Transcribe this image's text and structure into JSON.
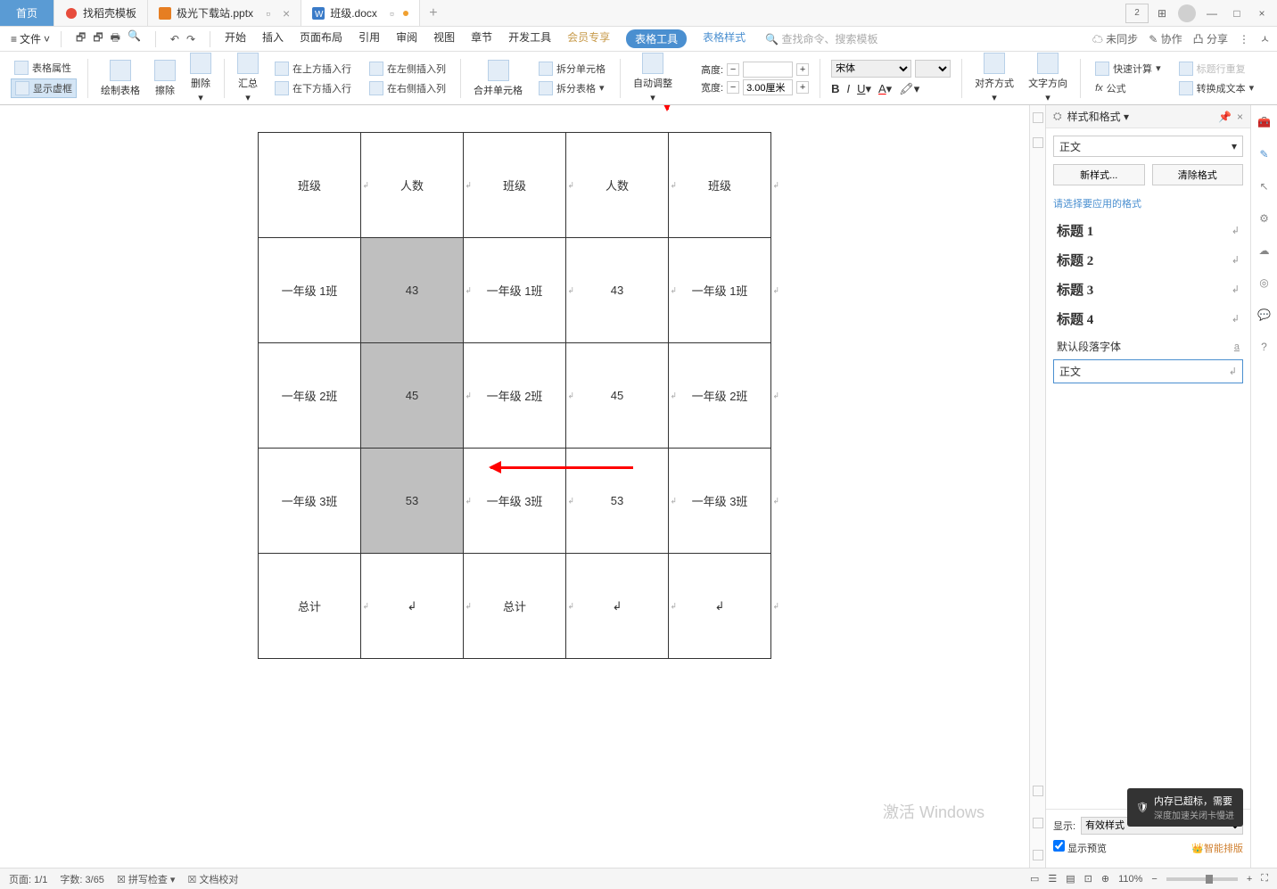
{
  "tabs": {
    "home": "首页",
    "t1": "找稻壳模板",
    "t2": "极光下载站.pptx",
    "t3": "班级.docx"
  },
  "win": {
    "num": "2"
  },
  "menu": {
    "file": "文件",
    "tabs": [
      "开始",
      "插入",
      "页面布局",
      "引用",
      "审阅",
      "视图",
      "章节",
      "开发工具",
      "会员专享"
    ],
    "tableTool": "表格工具",
    "tableStyle": "表格样式",
    "search": "查找命令、搜索模板",
    "unsync": "未同步",
    "coop": "协作",
    "share": "分享"
  },
  "ribbon": {
    "tableAttr": "表格属性",
    "showDash": "显示虚框",
    "drawTable": "绘制表格",
    "erase": "擦除",
    "delete": "删除",
    "summary": "汇总",
    "insTop": "在上方插入行",
    "insBottom": "在下方插入行",
    "insLeft": "在左侧插入列",
    "insRight": "在右侧插入列",
    "mergeCell": "合并单元格",
    "splitCell": "拆分单元格",
    "splitTable": "拆分表格",
    "autoFit": "自动调整",
    "height": "高度:",
    "width": "宽度:",
    "widthVal": "3.00厘米",
    "font": "宋体",
    "align": "对齐方式",
    "textDir": "文字方向",
    "quickCalc": "快速计算",
    "titleRepeat": "标题行重复",
    "formula": "公式",
    "toText": "转换成文本"
  },
  "table": {
    "h1": "班级",
    "h2": "人数",
    "h3": "班级",
    "h4": "人数",
    "h5": "班级",
    "r1c1": "一年级 1班",
    "r1c2": "43",
    "r1c3": "一年级 1班",
    "r1c4": "43",
    "r1c5": "一年级 1班",
    "r2c1": "一年级 2班",
    "r2c2": "45",
    "r2c3": "一年级 2班",
    "r2c4": "45",
    "r2c5": "一年级 2班",
    "r3c1": "一年级 3班",
    "r3c2": "53",
    "r3c3": "一年级 3班",
    "r3c4": "53",
    "r3c5": "一年级 3班",
    "r4c1": "总计",
    "r4c3": "总计"
  },
  "styles": {
    "title": "样式和格式",
    "current": "正文",
    "newStyle": "新样式...",
    "clearFmt": "清除格式",
    "pickLabel": "请选择要应用的格式",
    "h1": "标题 1",
    "h2": "标题 2",
    "h3": "标题 3",
    "h4": "标题 4",
    "defFont": "默认段落字体",
    "body": "正文",
    "showLabel": "显示:",
    "showVal": "有效样式",
    "preview": "显示预览",
    "smartLayout": "智能排版"
  },
  "status": {
    "page": "页面: 1/1",
    "words": "字数: 3/65",
    "spell": "拼写检查",
    "proof": "文档校对",
    "zoom": "110%"
  },
  "float": {
    "msg": "内存已超标，需要",
    "sub": "深度加速关闭卡慢进"
  },
  "watermark": "激活 Windows"
}
